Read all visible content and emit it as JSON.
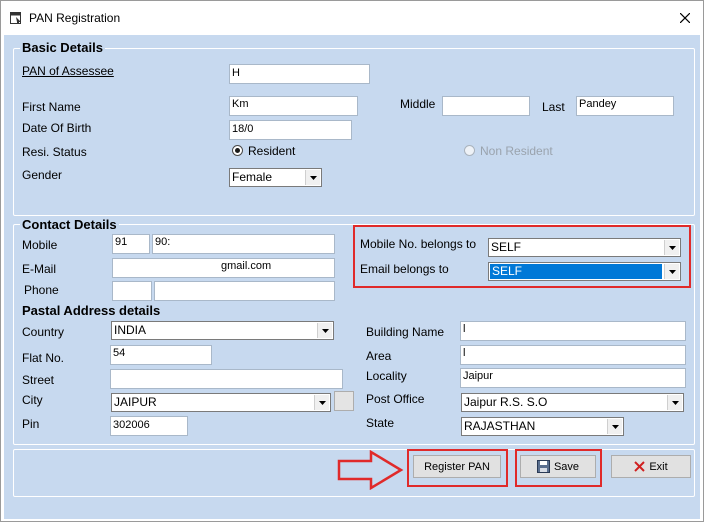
{
  "window": {
    "title": "PAN Registration"
  },
  "basic": {
    "section_title": "Basic Details",
    "pan_label": "PAN of Assessee",
    "pan_value": "H",
    "first_name_label": "First Name",
    "first_name_value": "Km",
    "middle_label": "Middle",
    "middle_value": "",
    "last_label": "Last",
    "last_value": "Pandey",
    "dob_label": "Date Of Birth",
    "dob_value": "18/0",
    "resi_label": "Resi. Status",
    "resident_label": "Resident",
    "non_resident_label": "Non Resident",
    "gender_label": "Gender",
    "gender_value": "Female"
  },
  "contact": {
    "section_title": "Contact Details",
    "mobile_label": "Mobile",
    "mobile_code": "91",
    "mobile_number": "90:",
    "email_label": "E-Mail",
    "email_value": "gmail.com",
    "phone_label": "Phone",
    "phone_code": "",
    "phone_number": "",
    "mobile_belongs_label": "Mobile No. belongs to",
    "mobile_belongs_value": "SELF",
    "email_belongs_label": "Email belongs to",
    "email_belongs_value": "SELF"
  },
  "address": {
    "section_title": "Pastal Address details",
    "country_label": "Country",
    "country_value": "INDIA",
    "flat_label": "Flat No.",
    "flat_value": "54",
    "street_label": "Street",
    "street_value": "",
    "city_label": "City",
    "city_value": "JAIPUR",
    "pin_label": "Pin",
    "pin_value": "302006",
    "building_label": "Building Name",
    "building_value": "l",
    "area_label": "Area",
    "area_value": "l",
    "locality_label": "Locality",
    "locality_value": "Jaipur",
    "post_office_label": "Post Office",
    "post_office_value": "Jaipur R.S. S.O",
    "state_label": "State",
    "state_value": "RAJASTHAN"
  },
  "buttons": {
    "register_label": "Register PAN",
    "save_label": "Save",
    "exit_label": "Exit"
  },
  "colors": {
    "client_bg": "#c7d9ef",
    "highlight_red": "#e02a2a",
    "selection_blue": "#0078d7"
  }
}
